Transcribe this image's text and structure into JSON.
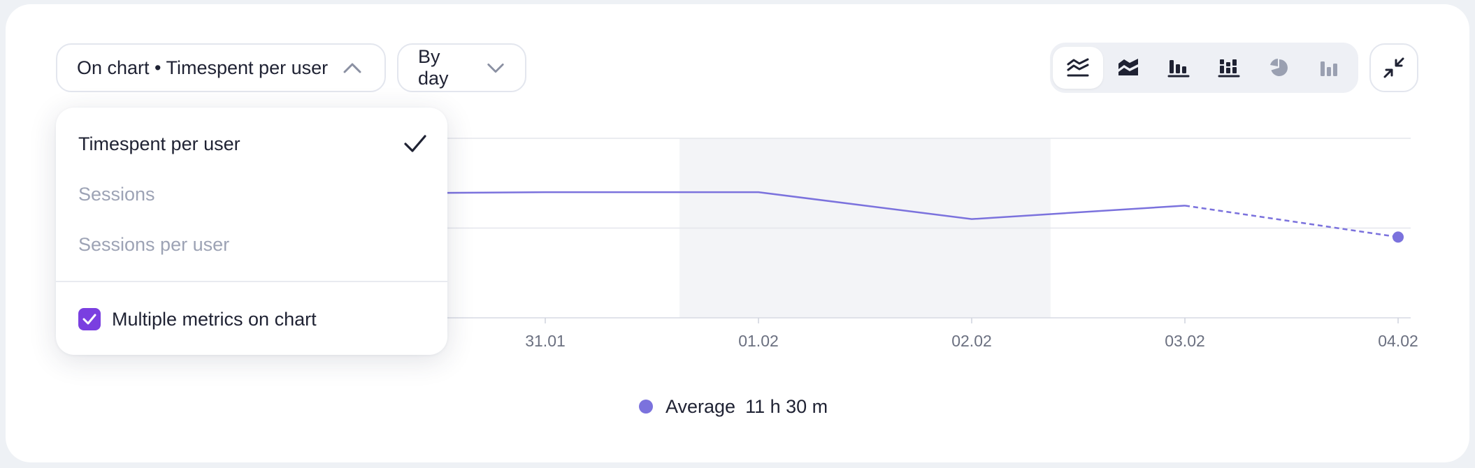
{
  "controls": {
    "metric_select_label": "On chart • Timespent per user",
    "period_select_label": "By day",
    "chart_type_buttons": [
      "line-chart-icon",
      "area-chart-icon",
      "bar-chart-icon",
      "stacked-bar-chart-icon",
      "pie-chart-icon",
      "column-chart-icon"
    ],
    "active_chart_type": "line-chart-icon"
  },
  "dropdown": {
    "items": [
      {
        "label": "Timespent per user",
        "selected": true
      },
      {
        "label": "Sessions",
        "selected": false
      },
      {
        "label": "Sessions per user",
        "selected": false
      }
    ],
    "multiple_metrics_label": "Multiple metrics on chart",
    "multiple_metrics_checked": true
  },
  "legend": {
    "series_name": "Average",
    "value": "11 h 30 m"
  },
  "colors": {
    "series": "#7b72dd",
    "checkbox": "#7a3fe0",
    "weekend_band": "#f3f4f7"
  },
  "chart_data": {
    "type": "line",
    "categories": [
      "31.01",
      "01.02",
      "02.02",
      "03.02",
      "04.02"
    ],
    "series": [
      {
        "name": "Average",
        "values": [
          12.0,
          12.0,
          11.7,
          11.85,
          11.5
        ],
        "last_segment_dashed": true
      }
    ],
    "highlight_band": [
      "01.02",
      "02.02"
    ],
    "grid": true
  }
}
